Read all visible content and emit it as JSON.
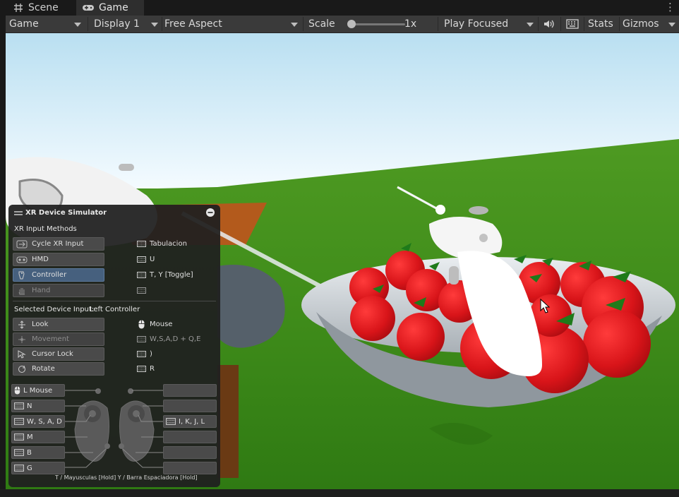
{
  "tabs": [
    {
      "label": "Scene",
      "icon": "grid-icon"
    },
    {
      "label": "Game",
      "icon": "gamepad-icon"
    }
  ],
  "toolbar": {
    "game_view": "Game",
    "display": "Display 1",
    "aspect": "Free Aspect",
    "scale_label": "Scale",
    "scale_value": "1x",
    "scale_fraction": 0.0,
    "play_mode": "Play Focused",
    "stats": "Stats",
    "gizmos": "Gizmos"
  },
  "xr_panel": {
    "title": "XR Device Simulator",
    "methods_heading": "XR Input Methods",
    "methods": [
      {
        "label": "Cycle XR Input",
        "key": "Tabulacion",
        "icon": "cycle-icon",
        "state": "normal"
      },
      {
        "label": "HMD",
        "key": "U",
        "icon": "hmd-icon",
        "state": "normal"
      },
      {
        "label": "Controller",
        "key": "T, Y [Toggle]",
        "icon": "controller-icon",
        "state": "selected"
      },
      {
        "label": "Hand",
        "key": "",
        "icon": "hand-icon",
        "state": "disabled"
      }
    ],
    "device_input_label": "Selected Device Input:",
    "device_input_value": "Left Controller",
    "inputs": [
      {
        "label": "Look",
        "key": "Mouse",
        "icon": "look-icon",
        "key_icon": "mouse-icon",
        "state": "normal"
      },
      {
        "label": "Movement",
        "key": "W,S,A,D + Q,E",
        "icon": "movement-icon",
        "key_icon": "keyboard-icon",
        "state": "disabled"
      },
      {
        "label": "Cursor Lock",
        "key": ")",
        "icon": "cursor-lock-icon",
        "key_icon": "keyboard-icon",
        "state": "normal"
      },
      {
        "label": "Rotate",
        "key": "R",
        "icon": "rotate-icon",
        "key_icon": "keyboard-icon",
        "state": "normal"
      }
    ],
    "left_mappings": [
      {
        "label": "L Mouse",
        "icon": "mouse-icon"
      },
      {
        "label": "N",
        "icon": "keyboard-icon"
      },
      {
        "label": "W, S, A, D",
        "icon": "keyboard-icon"
      },
      {
        "label": "M",
        "icon": "keyboard-icon"
      },
      {
        "label": "B",
        "icon": "keyboard-icon"
      },
      {
        "label": "G",
        "icon": "keyboard-icon"
      }
    ],
    "right_mappings": [
      {
        "label": "",
        "icon": ""
      },
      {
        "label": "",
        "icon": ""
      },
      {
        "label": "I, K, J, L",
        "icon": "keyboard-icon"
      },
      {
        "label": "",
        "icon": ""
      },
      {
        "label": "",
        "icon": ""
      },
      {
        "label": "",
        "icon": ""
      }
    ],
    "footer": "T / Mayusculas [Hold]   Y / Barra Espaciadora [Hold]"
  },
  "colors": {
    "sky_top": "#b9dff1",
    "sky_bottom": "#f4fbff",
    "grass": "#3d8a1c",
    "apple": "#d81419",
    "leaf": "#1f7a1a",
    "selected_button": "#46607e"
  }
}
